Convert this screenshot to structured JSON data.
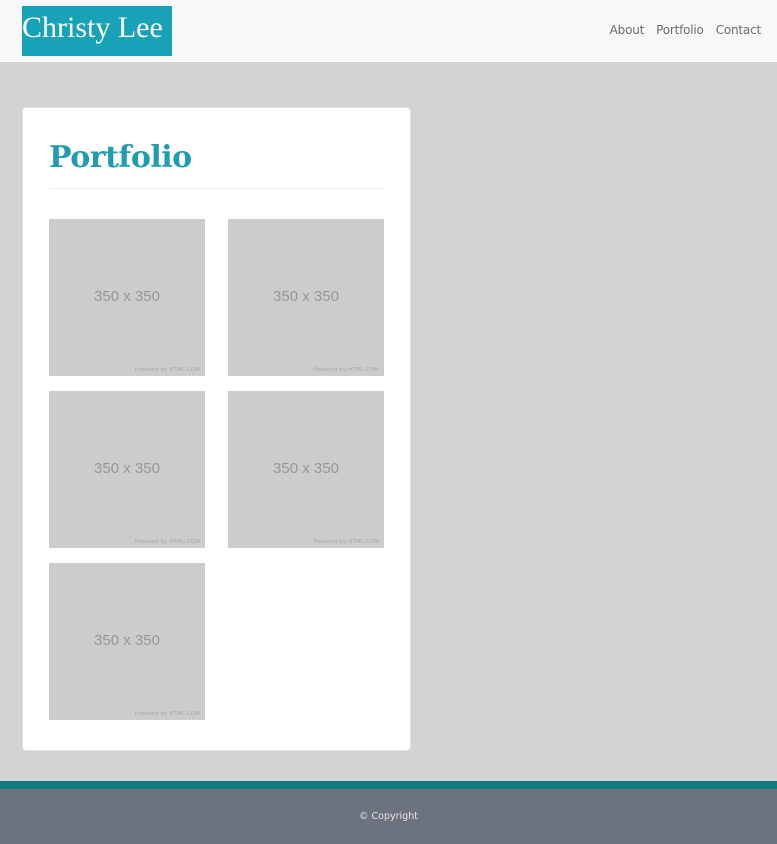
{
  "header": {
    "brand": "Christy Lee",
    "nav": [
      "About",
      "Portfolio",
      "Contact"
    ]
  },
  "portfolio": {
    "title": "Portfolio",
    "items": [
      {
        "label": "350 x 350",
        "credit": "Powered by HTML.COM"
      },
      {
        "label": "350 x 350",
        "credit": "Powered by HTML.COM"
      },
      {
        "label": "350 x 350",
        "credit": "Powered by HTML.COM"
      },
      {
        "label": "350 x 350",
        "credit": "Powered by HTML.COM"
      },
      {
        "label": "350 x 350",
        "credit": "Powered by HTML.COM"
      }
    ]
  },
  "footer": {
    "copyright": "© Copyright"
  },
  "colors": {
    "accent": "#17a2b8",
    "title": "#1f9db0",
    "footer_bar": "#117b7e",
    "footer": "#6c737e",
    "page_background": "#d3d3d3"
  }
}
